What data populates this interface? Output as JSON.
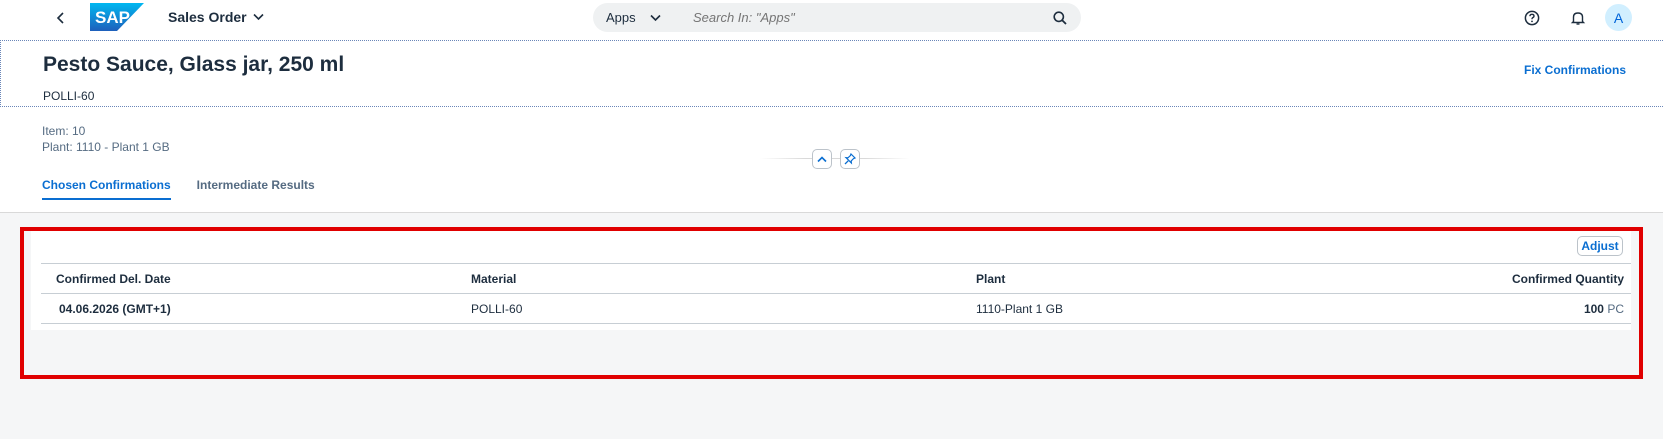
{
  "shell": {
    "logo_text": "SAP",
    "app_title": "Sales Order",
    "search_scope": "Apps",
    "search_placeholder": "Search In: \"Apps\"",
    "avatar_initial": "A"
  },
  "header": {
    "title": "Pesto Sauce, Glass jar, 250 ml",
    "subtitle": "POLLI-60",
    "fix_link": "Fix Confirmations",
    "item": "Item: 10",
    "plant": "Plant: 1110 - Plant 1 GB"
  },
  "tabs": [
    {
      "label": "Chosen Confirmations",
      "active": true
    },
    {
      "label": "Intermediate Results",
      "active": false
    }
  ],
  "table": {
    "adjust_label": "Adjust",
    "columns": [
      "Confirmed Del. Date",
      "Material",
      "Plant",
      "Confirmed Quantity"
    ],
    "rows": [
      {
        "date": "04.06.2026 (GMT+1)",
        "material": "POLLI-60",
        "plant": "1110-Plant 1 GB",
        "qty": "100",
        "unit": "PC"
      }
    ]
  },
  "colors": {
    "accent": "#0a6ed1",
    "highlight": "#e00000"
  }
}
